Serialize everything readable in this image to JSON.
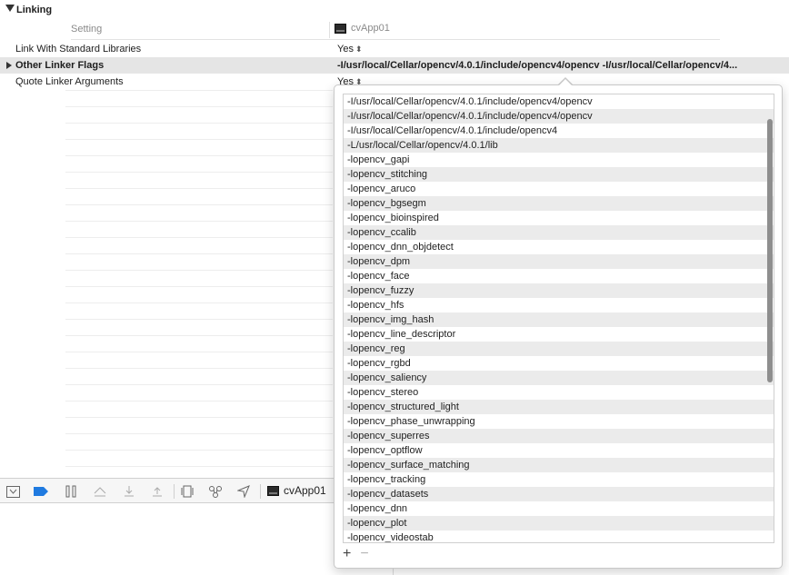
{
  "section": {
    "title": "Linking"
  },
  "columns": {
    "setting": "Setting",
    "target": "cvApp01"
  },
  "rows": [
    {
      "label": "Link With Standard Libraries",
      "value": "Yes",
      "chevron": "⬍"
    },
    {
      "label": "Other Linker Flags",
      "value": "-I/usr/local/Cellar/opencv/4.0.1/include/opencv4/opencv -I/usr/local/Cellar/opencv/4..."
    },
    {
      "label": "Quote Linker Arguments",
      "value": "Yes",
      "chevron": "⬍"
    }
  ],
  "debug_bar": {
    "scheme": "cvApp01"
  },
  "popover": {
    "items": [
      "-I/usr/local/Cellar/opencv/4.0.1/include/opencv4/opencv",
      "-I/usr/local/Cellar/opencv/4.0.1/include/opencv4/opencv",
      "-I/usr/local/Cellar/opencv/4.0.1/include/opencv4",
      "-L/usr/local/Cellar/opencv/4.0.1/lib",
      "-lopencv_gapi",
      "-lopencv_stitching",
      "-lopencv_aruco",
      "-lopencv_bgsegm",
      "-lopencv_bioinspired",
      "-lopencv_ccalib",
      "-lopencv_dnn_objdetect",
      "-lopencv_dpm",
      "-lopencv_face",
      "-lopencv_fuzzy",
      "-lopencv_hfs",
      "-lopencv_img_hash",
      "-lopencv_line_descriptor",
      "-lopencv_reg",
      "-lopencv_rgbd",
      "-lopencv_saliency",
      "-lopencv_stereo",
      "-lopencv_structured_light",
      "-lopencv_phase_unwrapping",
      "-lopencv_superres",
      "-lopencv_optflow",
      "-lopencv_surface_matching",
      "-lopencv_tracking",
      "-lopencv_datasets",
      "-lopencv_dnn",
      "-lopencv_plot",
      "-lopencv_videostab"
    ],
    "add_label": "+",
    "remove_label": "−"
  },
  "icons": {
    "disclosure": "disclosure-triangle-icon",
    "target": "terminal-target-icon"
  }
}
